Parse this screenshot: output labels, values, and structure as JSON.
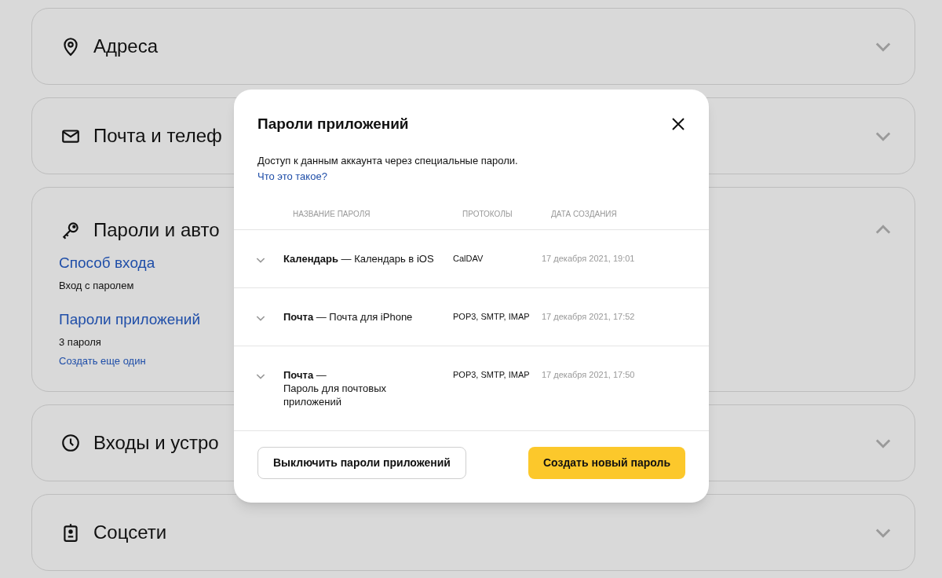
{
  "sections": [
    {
      "kind": "pin",
      "title": "Адреса",
      "expanded": false
    },
    {
      "kind": "mail",
      "title": "Почта и телеф",
      "expanded": false
    },
    {
      "kind": "key",
      "title": "Пароли и авто",
      "expanded": true,
      "items": [
        {
          "link": "Способ входа",
          "lines": [
            "Вход с паролем"
          ]
        },
        {
          "link": "Пароли приложений",
          "lines": [
            "3 пароля"
          ],
          "action": "Создать еще один"
        }
      ]
    },
    {
      "kind": "clock",
      "title": "Входы и устро",
      "expanded": false
    },
    {
      "kind": "badge",
      "title": "Соцсети",
      "expanded": false
    }
  ],
  "dialog": {
    "title": "Пароли приложений",
    "description": "Доступ к данным аккаунта через специальные пароли.",
    "help_link": "Что это такое?",
    "columns": [
      "НАЗВАНИЕ ПАРОЛЯ",
      "ПРОТОКОЛЫ",
      "ДАТА СОЗДАНИЯ"
    ],
    "rows": [
      {
        "title": "**Календарь** — Календарь в iOS",
        "protocols": "CalDAV",
        "created": "17 декабря 2021, 19:01",
        "expanded": false
      },
      {
        "title": "**Почта** — Почта для iPhone",
        "protocols": "POP3, SMTP, IMAP",
        "created": "17 декабря 2021, 17:52",
        "expanded": false
      },
      {
        "title": "**Почта** —",
        "subtitle": "Пароль для почтовых приложений",
        "protocols": "POP3, SMTP, IMAP",
        "created": "17 декабря 2021, 17:50",
        "expanded": false
      }
    ],
    "buttons": [
      {
        "label": "Выключить пароли приложений",
        "kind": "secondary"
      },
      {
        "label": "Создать новый пароль",
        "kind": "primary"
      }
    ]
  }
}
